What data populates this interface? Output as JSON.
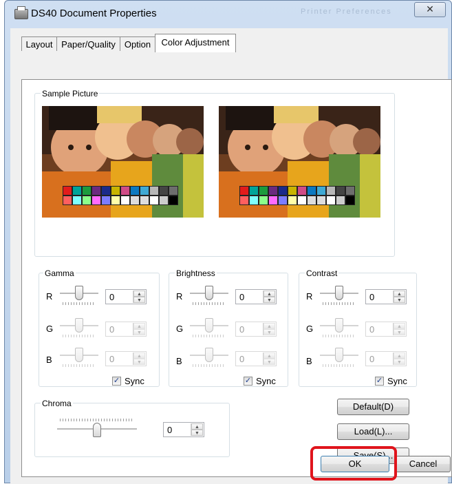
{
  "window": {
    "title": "DS40 Document Properties",
    "title_extra": "Printer Preferences",
    "close_glyph": "✕",
    "icon": "printer-icon"
  },
  "tabs": [
    {
      "label": "Layout",
      "active": false
    },
    {
      "label": "Paper/Quality",
      "active": false
    },
    {
      "label": "Option",
      "active": false
    },
    {
      "label": "Color Adjustment",
      "active": true
    }
  ],
  "sample_picture": {
    "label": "Sample Picture",
    "swatch_row1": [
      "#e21b1b",
      "#00a49a",
      "#1c9b3d",
      "#6b2a7f",
      "#1b2a8a",
      "#c8b400",
      "#cf4b87",
      "#0c79c1",
      "#3fa9d4",
      "#b7b7b7",
      "#444444",
      "#6d6d6d"
    ],
    "swatch_row2": [
      "#ff5f5f",
      "#7fffff",
      "#8bff8b",
      "#ff6bff",
      "#7c7cff",
      "#ffffa8",
      "#ffffff",
      "#dddddd",
      "#dddddd",
      "#ffffff",
      "#cccccc",
      "#000000"
    ]
  },
  "gamma": {
    "label": "Gamma",
    "rows": [
      {
        "channel": "R",
        "value": "0",
        "enabled": true
      },
      {
        "channel": "G",
        "value": "0",
        "enabled": false
      },
      {
        "channel": "B",
        "value": "0",
        "enabled": false
      }
    ],
    "sync_label": "Sync",
    "sync_checked": true
  },
  "brightness": {
    "label": "Brightness",
    "rows": [
      {
        "channel": "R",
        "value": "0",
        "enabled": true
      },
      {
        "channel": "G",
        "value": "0",
        "enabled": false
      },
      {
        "channel": "B",
        "value": "0",
        "enabled": false
      }
    ],
    "sync_label": "Sync",
    "sync_checked": true
  },
  "contrast": {
    "label": "Contrast",
    "rows": [
      {
        "channel": "R",
        "value": "0",
        "enabled": true
      },
      {
        "channel": "G",
        "value": "0",
        "enabled": false
      },
      {
        "channel": "B",
        "value": "0",
        "enabled": false
      }
    ],
    "sync_label": "Sync",
    "sync_checked": true
  },
  "chroma": {
    "label": "Chroma",
    "value": "0"
  },
  "buttons": {
    "default": "Default(D)",
    "load": "Load(L)...",
    "save": "Save(S)...",
    "ok": "OK",
    "cancel": "Cancel"
  },
  "highlight_color": "#e0141c",
  "checkmark": "✓",
  "spin_up_glyph": "▲",
  "spin_down_glyph": "▼"
}
